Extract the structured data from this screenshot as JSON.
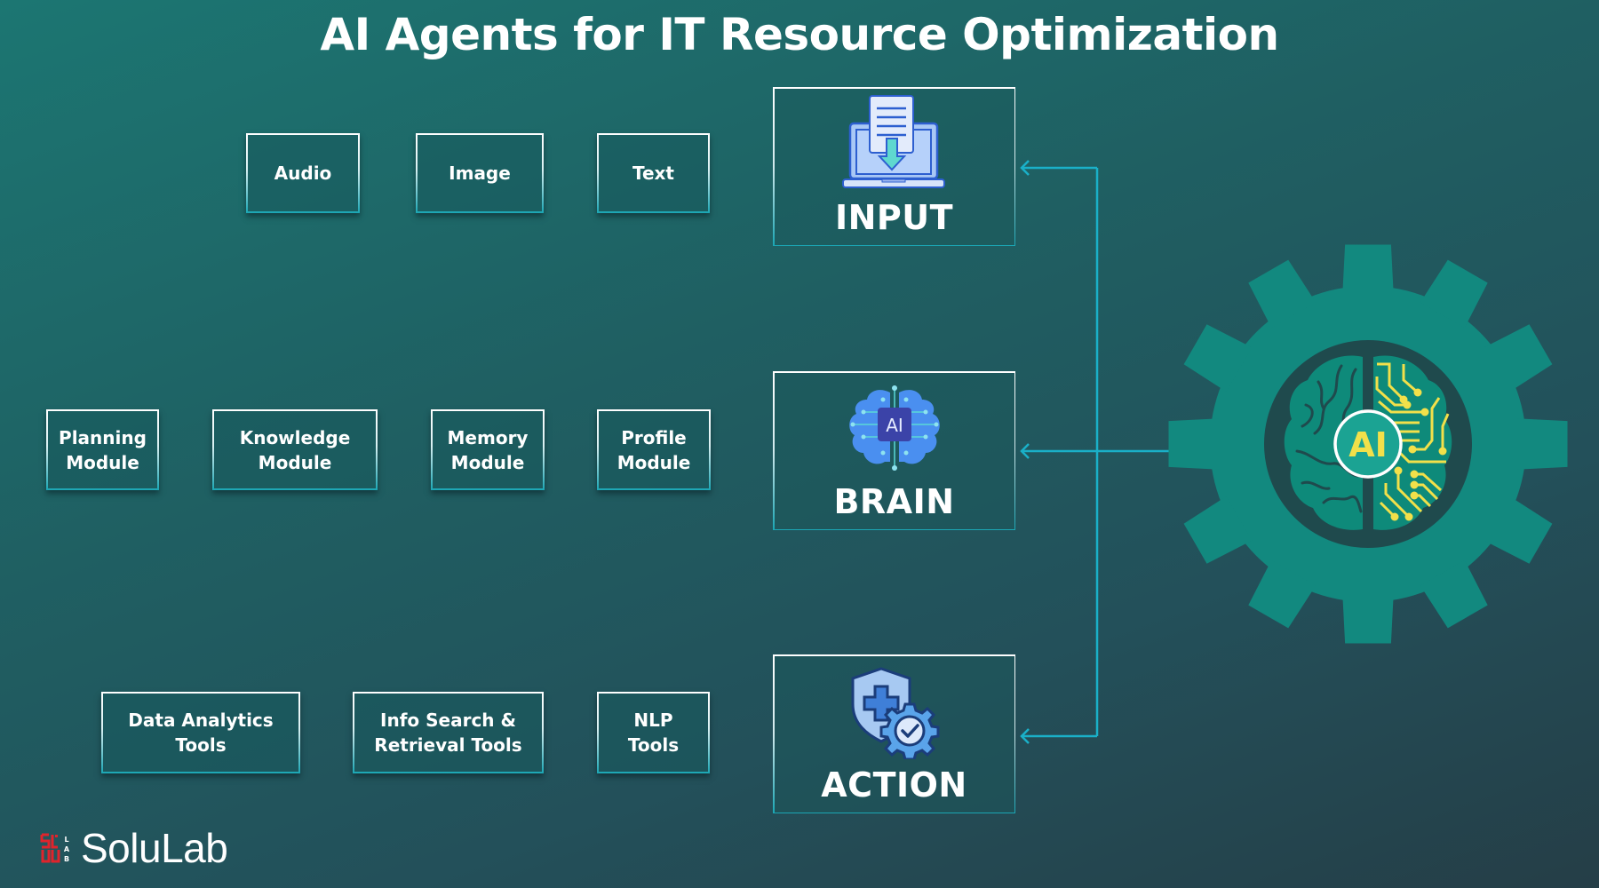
{
  "title": "AI Agents for IT Resource Optimization",
  "input_row": {
    "items": [
      {
        "label": "Audio"
      },
      {
        "label": "Image"
      },
      {
        "label": "Text"
      }
    ]
  },
  "brain_row": {
    "items": [
      {
        "label": "Planning\nModule"
      },
      {
        "label": "Knowledge\nModule"
      },
      {
        "label": "Memory\nModule"
      },
      {
        "label": "Profile\nModule"
      }
    ]
  },
  "action_row": {
    "items": [
      {
        "label": "Data Analytics\nTools"
      },
      {
        "label": "Info Search &\nRetrieval Tools"
      },
      {
        "label": "NLP\nTools"
      }
    ]
  },
  "stages": {
    "input": {
      "label": "INPUT",
      "icon": "laptop-download-icon"
    },
    "brain": {
      "label": "BRAIN",
      "icon": "ai-brain-icon"
    },
    "action": {
      "label": "ACTION",
      "icon": "shield-gear-icon"
    }
  },
  "hub": {
    "badge": "AI",
    "icon": "gear-ai-brain-icon"
  },
  "logo": {
    "brand": "SoluLab",
    "mark_text": "LAB"
  },
  "colors": {
    "connector": "#1ab0c8",
    "gear": "#12897f",
    "hub_dark": "#1f4a4d",
    "circuit_yellow": "#f2e04a",
    "logo_red": "#e0242c"
  }
}
